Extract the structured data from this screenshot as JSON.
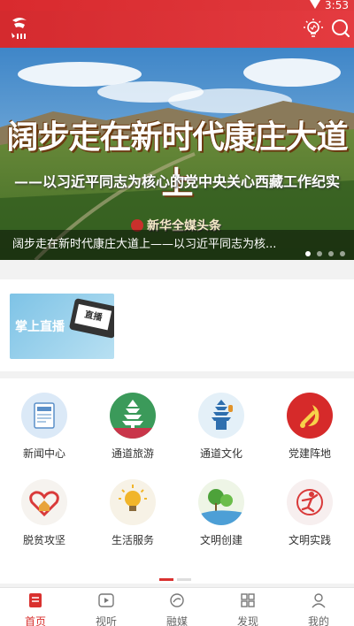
{
  "status_bar": {
    "time": "3:53"
  },
  "banner": {
    "title": "阔步走在新时代康庄大道上",
    "subtitle": "——以习近平同志为核心的党中央关心西藏工作纪实",
    "brand": "新华全媒头条",
    "caption": "阔步走在新时代康庄大道上——以习近平同志为核...",
    "slide_count": 4,
    "active_slide": 1
  },
  "live": {
    "label": "掌上直播",
    "screen_text": "直播"
  },
  "grid": {
    "items": [
      {
        "label": "新闻中心",
        "icon": "newspaper-icon"
      },
      {
        "label": "通道旅游",
        "icon": "pagoda-travel-icon"
      },
      {
        "label": "通道文化",
        "icon": "drum-tower-icon"
      },
      {
        "label": "党建阵地",
        "icon": "party-emblem-icon"
      },
      {
        "label": "脱贫攻坚",
        "icon": "heart-house-icon"
      },
      {
        "label": "生活服务",
        "icon": "lightbulb-icon"
      },
      {
        "label": "文明创建",
        "icon": "landscape-icon"
      },
      {
        "label": "文明实践",
        "icon": "volunteer-icon"
      }
    ],
    "page_count": 2,
    "active_page": 1
  },
  "bottom_nav": {
    "tabs": [
      {
        "label": "首页",
        "icon": "home-icon",
        "active": true
      },
      {
        "label": "视听",
        "icon": "play-icon",
        "active": false
      },
      {
        "label": "融媒",
        "icon": "media-icon",
        "active": false
      },
      {
        "label": "发现",
        "icon": "grid-icon",
        "active": false
      },
      {
        "label": "我的",
        "icon": "profile-icon",
        "active": false
      }
    ]
  },
  "colors": {
    "brand_red": "#d9312f",
    "header_red": "#e0393d"
  }
}
